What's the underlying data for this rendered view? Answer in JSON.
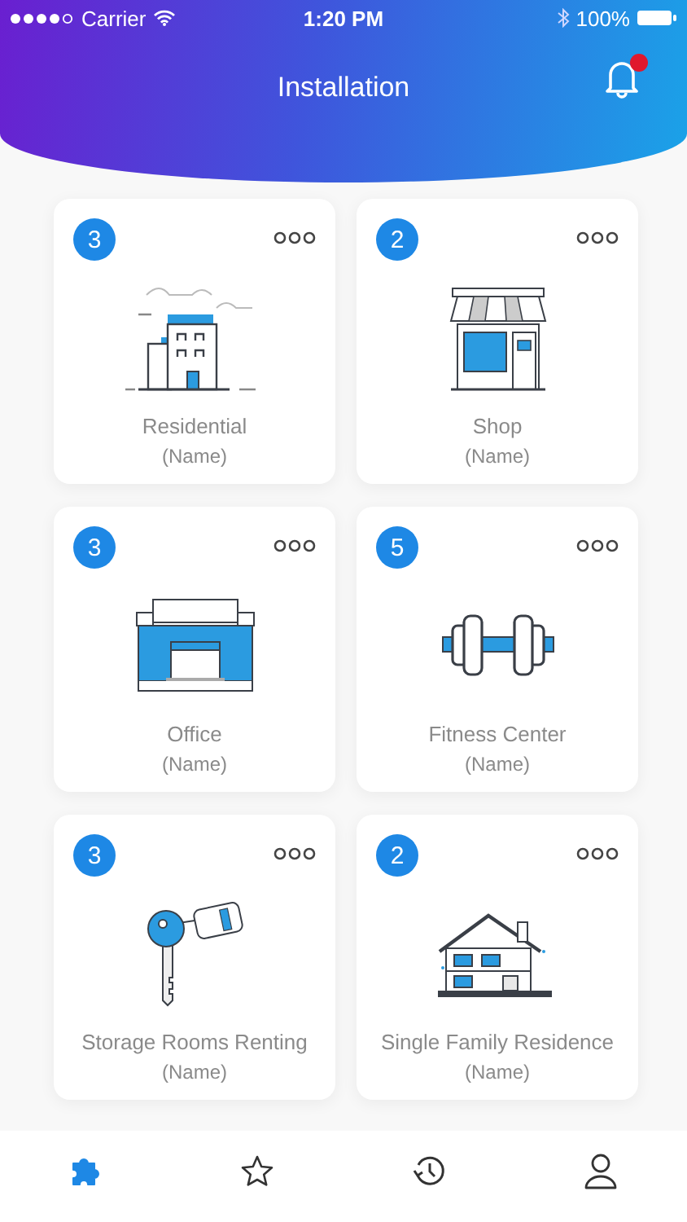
{
  "status_bar": {
    "carrier": "Carrier",
    "time": "1:20 PM",
    "battery": "100%"
  },
  "header": {
    "title": "Installation",
    "notification": true
  },
  "cards": [
    {
      "kind": "residential",
      "count": "3",
      "title": "Residential",
      "subtitle": "(Name)"
    },
    {
      "kind": "shop",
      "count": "2",
      "title": "Shop",
      "subtitle": "(Name)"
    },
    {
      "kind": "office",
      "count": "3",
      "title": "Office",
      "subtitle": "(Name)"
    },
    {
      "kind": "fitness",
      "count": "5",
      "title": "Fitness Center",
      "subtitle": "(Name)"
    },
    {
      "kind": "storage",
      "count": "3",
      "title": "Storage Rooms Renting",
      "subtitle": "(Name)"
    },
    {
      "kind": "house",
      "count": "2",
      "title": "Single Family Residence",
      "subtitle": "(Name)"
    }
  ],
  "tab_bar": [
    {
      "kind": "puzzle",
      "selected": true
    },
    {
      "kind": "star",
      "selected": false
    },
    {
      "kind": "history",
      "selected": false
    },
    {
      "kind": "profile",
      "selected": false
    }
  ]
}
